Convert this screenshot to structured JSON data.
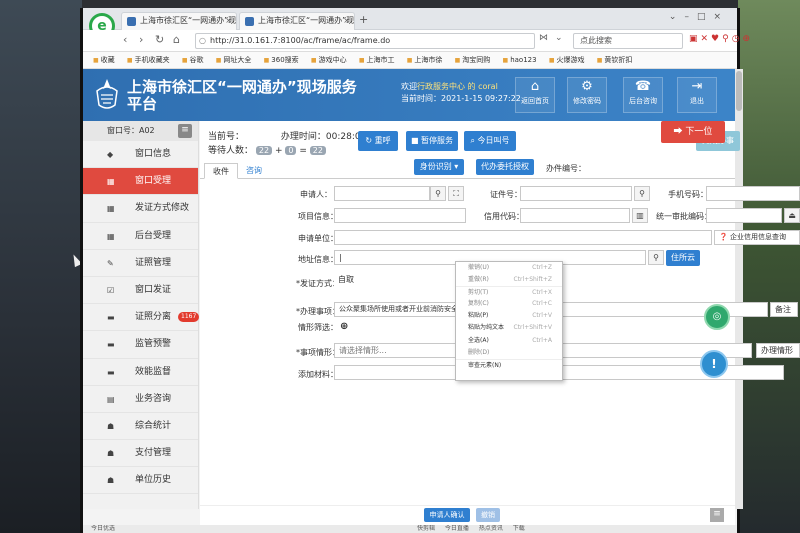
{
  "browser": {
    "tabs": [
      {
        "label": "上海市徐汇区“一网通办”现场"
      },
      {
        "label": "上海市徐汇区“一网通办”现场"
      }
    ],
    "url": "http://31.0.161.7:8100/ac/frame/ac/frame.do",
    "search_placeholder": "点此搜索",
    "bookmarks": [
      "收藏",
      "手机收藏夹",
      "谷歌",
      "网址大全",
      "360搜索",
      "游戏中心",
      "上海市工",
      "上海市徐",
      "淘宝同购",
      "hao123",
      "火爆游戏",
      "黄钦折扣"
    ]
  },
  "header": {
    "title": "上海市徐汇区“一网通办”现场服务平台",
    "welcome_prefix": "欢迎",
    "welcome_user": "行政服务中心 的 coral",
    "time_label": "当前时间：",
    "time_value": "2021-1-15 09:27:22",
    "buttons": [
      {
        "icon": "home-icon",
        "glyph": "⌂",
        "label": "返回首页"
      },
      {
        "icon": "gear-icon",
        "glyph": "⚙",
        "label": "修改密码"
      },
      {
        "icon": "phone-icon",
        "glyph": "☎",
        "label": "后台咨询"
      },
      {
        "icon": "exit-icon",
        "glyph": "⇥",
        "label": "退出"
      }
    ]
  },
  "sidebar": {
    "window_number": "窗口号：A02",
    "items": [
      {
        "label": "窗口信息",
        "icon": "tag-icon",
        "glyph": "◆"
      },
      {
        "label": "窗口受理",
        "icon": "grid-icon",
        "glyph": "▦",
        "active": true
      },
      {
        "label": "发证方式修改",
        "icon": "grid-icon",
        "glyph": "▦"
      },
      {
        "label": "后台受理",
        "icon": "grid-icon",
        "glyph": "▦"
      },
      {
        "label": "证照管理",
        "icon": "edit-icon",
        "glyph": "✎"
      },
      {
        "label": "窗口发证",
        "icon": "checkbox-icon",
        "glyph": "☑"
      },
      {
        "label": "证照分离",
        "icon": "chat-icon",
        "glyph": "▬",
        "badge": "1167"
      },
      {
        "label": "监管预警",
        "icon": "chat-icon",
        "glyph": "▬"
      },
      {
        "label": "效能监督",
        "icon": "chat-icon",
        "glyph": "▬"
      },
      {
        "label": "业务咨询",
        "icon": "doc-icon",
        "glyph": "▤"
      },
      {
        "label": "综合统计",
        "icon": "stats-icon",
        "glyph": "☗"
      },
      {
        "label": "支付管理",
        "icon": "stats-icon",
        "glyph": "☗"
      },
      {
        "label": "单位历史",
        "icon": "stats-icon",
        "glyph": "☗"
      }
    ]
  },
  "queue": {
    "current_label": "当前号：",
    "handle_time_label": "办理时间：",
    "handle_time": "00:28:05",
    "waiting_label": "等待人数：",
    "waiting_a": "22",
    "plus": "+",
    "waiting_b": "0",
    "equals": "=",
    "waiting_total": "22"
  },
  "actions": {
    "recall": "重呼",
    "pause": "暂停服务",
    "today_calls": "今日叫号",
    "finish": "完成办事",
    "next": "下一位"
  },
  "form": {
    "tabs": [
      "收件",
      "咨询"
    ],
    "id_recognize": "身份识别 ▾",
    "proxy": "代办委托授权",
    "case_no_label": "办件编号：",
    "applicant_label": "申请人：",
    "cert_no_label": "证件号：",
    "phone_label": "手机号码：",
    "project_info_label": "项目信息：",
    "credit_code_label": "信用代码：",
    "unified_code_label": "统一审批编码：",
    "applicant_unit_label": "申请单位：",
    "enterprise_query": "企业信用信息查询",
    "address_label": "地址信息：",
    "address_value": "|",
    "residence_btn": "住所云",
    "delivery_label": "*发证方式：",
    "delivery_value": "自取",
    "matter_label": "*办理事项：",
    "matter_value": "公众聚集场所使用或者开业前消防安全检查",
    "remark_btn": "备注",
    "situation_filter_label": "情形筛选：",
    "matter_situation_label": "*事项情形：",
    "matter_situation_placeholder": "请选择情形...",
    "handle_situation_btn": "办理情形",
    "materials_label": "添加材料：",
    "confirm_btn": "申请人确认",
    "cancel_btn": "撤销"
  },
  "context_menu": [
    {
      "label": "撤销(U)",
      "key": "Ctrl+Z",
      "enabled": false
    },
    {
      "label": "重做(R)",
      "key": "Ctrl+Shift+Z",
      "enabled": false
    },
    {
      "label": "剪切(T)",
      "key": "Ctrl+X",
      "enabled": false,
      "sep": true
    },
    {
      "label": "复制(C)",
      "key": "Ctrl+C",
      "enabled": false
    },
    {
      "label": "粘贴(P)",
      "key": "Ctrl+V",
      "enabled": true
    },
    {
      "label": "粘贴为纯文本",
      "key": "Ctrl+Shift+V",
      "enabled": true
    },
    {
      "label": "全选(A)",
      "key": "Ctrl+A",
      "enabled": true
    },
    {
      "label": "删除(D)",
      "key": "",
      "enabled": false
    },
    {
      "label": "审查元素(N)",
      "key": "",
      "enabled": true,
      "sep": true
    }
  ],
  "statusbar": [
    "今日优选",
    "快剪辑",
    "今日直播",
    "热点资讯",
    "下载"
  ]
}
